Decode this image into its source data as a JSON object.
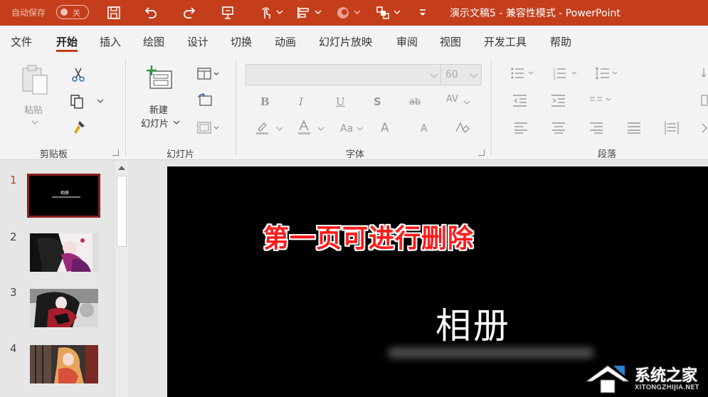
{
  "titlebar": {
    "autosave_label": "自动保存",
    "autosave_state": "关",
    "doc_title": "演示文稿5  -  兼容性模式  -  PowerPoint",
    "bg_color": "#c43e1c"
  },
  "quick_access": [
    "save-icon",
    "undo-icon",
    "redo-icon",
    "presenter-icon",
    "touch-mode-icon",
    "align-icon",
    "shape-fill-icon",
    "arrange-icon",
    "customize-icon"
  ],
  "tabs": [
    {
      "label": "文件"
    },
    {
      "label": "开始",
      "active": true
    },
    {
      "label": "插入"
    },
    {
      "label": "绘图"
    },
    {
      "label": "设计"
    },
    {
      "label": "切换"
    },
    {
      "label": "动画"
    },
    {
      "label": "幻灯片放映"
    },
    {
      "label": "审阅"
    },
    {
      "label": "视图"
    },
    {
      "label": "开发工具"
    },
    {
      "label": "帮助"
    }
  ],
  "ribbon": {
    "clipboard": {
      "group_label": "剪贴板",
      "paste_label": "粘贴"
    },
    "slides": {
      "group_label": "幻灯片",
      "new_slide_line1": "新建",
      "new_slide_line2": "幻灯片"
    },
    "font": {
      "group_label": "字体",
      "font_size": "60",
      "buttons": [
        "B",
        "I",
        "U",
        "S",
        "ab",
        "AV",
        "Aa",
        "A",
        "A"
      ]
    },
    "paragraph": {
      "group_label": "段落"
    }
  },
  "slides_panel": {
    "slides": [
      {
        "number": "1",
        "selected": true,
        "caption": "相册"
      },
      {
        "number": "2"
      },
      {
        "number": "3"
      },
      {
        "number": "4"
      }
    ]
  },
  "slide": {
    "annotation": "第一页可进行删除",
    "title": "相册"
  },
  "watermark": {
    "text": "系统之家",
    "sub": "XITONGZHIJIA.NET"
  }
}
